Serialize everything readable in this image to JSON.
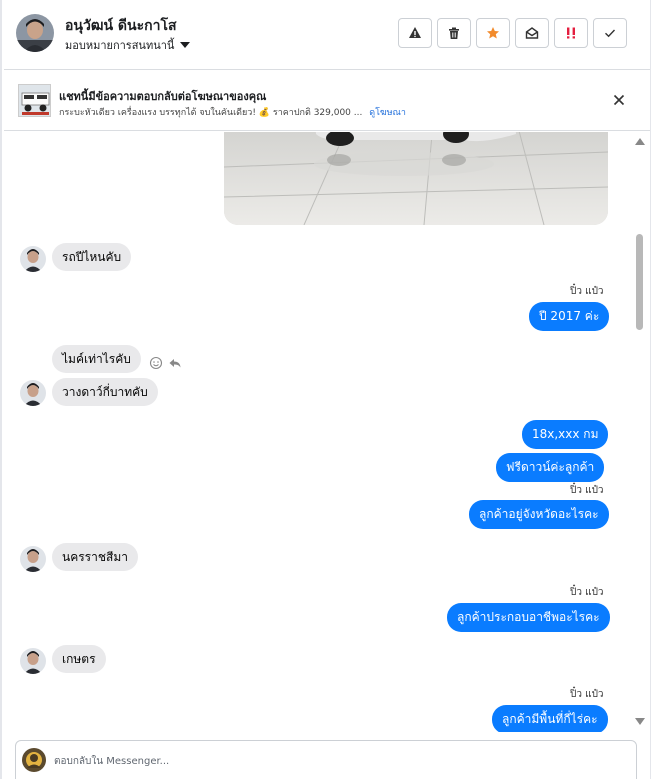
{
  "header": {
    "contact_name": "อนุวัฒน์ ดีนะกาโส",
    "assign_label": "มอบหมายการสนทนานี้",
    "actions": [
      "spam-icon",
      "trash-icon",
      "star-icon",
      "mark-unread-icon",
      "important-icon",
      "done-icon"
    ]
  },
  "ad_banner": {
    "title": "แชทนี้มีข้อความตอบกลับต่อโฆษณาของคุณ",
    "description": "กระบะหัวเดียว เครื่องแรง บรรทุกได้ จบในคันเดียว! 💰 ราคาปกติ 329,000 ...",
    "link": "ดูโฆษณา"
  },
  "messages": {
    "m1": "รถปีไหนคับ",
    "seen1": "ปิ๋ว แป๋ว",
    "m2": "ปี 2017  ค่ะ",
    "m3": "ไมค์เท่าไรคับ",
    "m4": "วางดาว์กี่บาทคับ",
    "m5": "18x,xxx   กม",
    "m6": "ฟรีดาวน์ค่ะลูกค้า",
    "seen2": "ปิ๋ว แป๋ว",
    "m7": "ลูกค้าอยู่จังหวัดอะไรคะ",
    "m8": "นครราชสีมา",
    "seen3": "ปิ๋ว แป๋ว",
    "m9": "ลูกค้าประกอบอาชีพอะไรคะ",
    "m10": "เกษตร",
    "seen4": "ปิ๋ว แป๋ว",
    "m11": "ลูกค้ามีพื้นที่กี่ไร่คะ"
  },
  "composer": {
    "placeholder": "ตอบกลับใน Messenger..."
  },
  "colors": {
    "outgoing_bubble": "#0a7cff",
    "incoming_bubble": "#e9e9eb",
    "star": "#f28b2c",
    "important": "#e41e3f"
  }
}
